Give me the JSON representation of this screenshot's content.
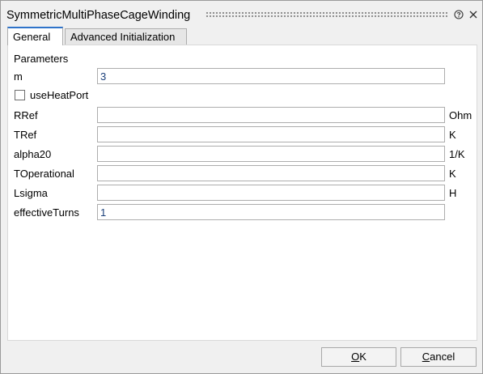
{
  "window": {
    "title": "SymmetricMultiPhaseCageWinding"
  },
  "tabs": [
    {
      "label": "General",
      "active": true
    },
    {
      "label": "Advanced Initialization",
      "active": false
    }
  ],
  "parameters": {
    "section_label": "Parameters",
    "m": {
      "label": "m",
      "value": "3"
    },
    "useHeatPort": {
      "label": "useHeatPort",
      "checked": false
    },
    "RRef": {
      "label": "RRef",
      "value": "",
      "unit": "Ohm"
    },
    "TRef": {
      "label": "TRef",
      "value": "",
      "unit": "K"
    },
    "alpha20": {
      "label": "alpha20",
      "value": "",
      "unit": "1/K"
    },
    "TOperational": {
      "label": "TOperational",
      "value": "",
      "unit": "K"
    },
    "Lsigma": {
      "label": "Lsigma",
      "value": "",
      "unit": "H"
    },
    "effectiveTurns": {
      "label": "effectiveTurns",
      "value": "1"
    }
  },
  "buttons": {
    "ok_first": "O",
    "ok_rest": "K",
    "cancel_first": "C",
    "cancel_rest": "ancel"
  },
  "colors": {
    "accent": "#2f73c9",
    "background": "#f0f0f0"
  },
  "icons": {
    "help": "help-icon",
    "close": "close-icon"
  }
}
